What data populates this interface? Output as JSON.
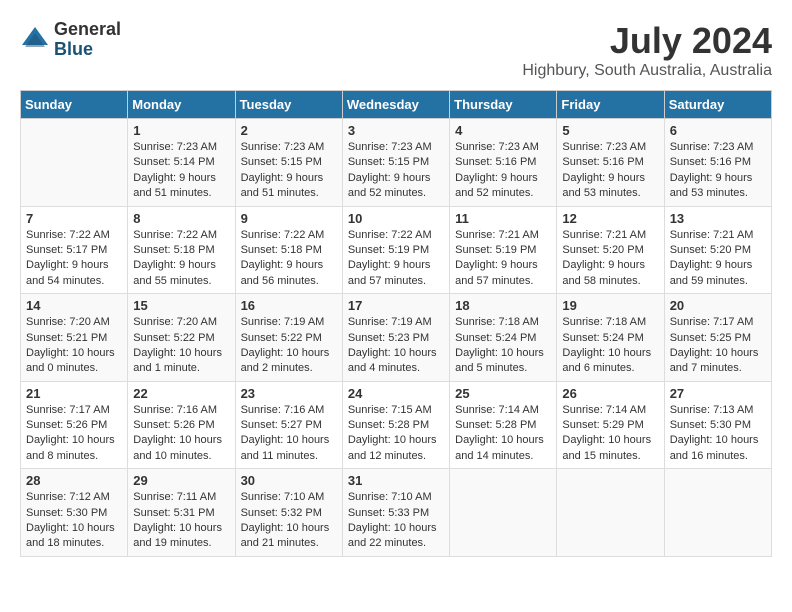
{
  "app": {
    "logo_general": "General",
    "logo_blue": "Blue"
  },
  "header": {
    "month": "July 2024",
    "location": "Highbury, South Australia, Australia"
  },
  "weekdays": [
    "Sunday",
    "Monday",
    "Tuesday",
    "Wednesday",
    "Thursday",
    "Friday",
    "Saturday"
  ],
  "weeks": [
    [
      {
        "day": "",
        "info": ""
      },
      {
        "day": "1",
        "info": "Sunrise: 7:23 AM\nSunset: 5:14 PM\nDaylight: 9 hours and 51 minutes."
      },
      {
        "day": "2",
        "info": "Sunrise: 7:23 AM\nSunset: 5:15 PM\nDaylight: 9 hours and 51 minutes."
      },
      {
        "day": "3",
        "info": "Sunrise: 7:23 AM\nSunset: 5:15 PM\nDaylight: 9 hours and 52 minutes."
      },
      {
        "day": "4",
        "info": "Sunrise: 7:23 AM\nSunset: 5:16 PM\nDaylight: 9 hours and 52 minutes."
      },
      {
        "day": "5",
        "info": "Sunrise: 7:23 AM\nSunset: 5:16 PM\nDaylight: 9 hours and 53 minutes."
      },
      {
        "day": "6",
        "info": "Sunrise: 7:23 AM\nSunset: 5:16 PM\nDaylight: 9 hours and 53 minutes."
      }
    ],
    [
      {
        "day": "7",
        "info": "Sunrise: 7:22 AM\nSunset: 5:17 PM\nDaylight: 9 hours and 54 minutes."
      },
      {
        "day": "8",
        "info": "Sunrise: 7:22 AM\nSunset: 5:18 PM\nDaylight: 9 hours and 55 minutes."
      },
      {
        "day": "9",
        "info": "Sunrise: 7:22 AM\nSunset: 5:18 PM\nDaylight: 9 hours and 56 minutes."
      },
      {
        "day": "10",
        "info": "Sunrise: 7:22 AM\nSunset: 5:19 PM\nDaylight: 9 hours and 57 minutes."
      },
      {
        "day": "11",
        "info": "Sunrise: 7:21 AM\nSunset: 5:19 PM\nDaylight: 9 hours and 57 minutes."
      },
      {
        "day": "12",
        "info": "Sunrise: 7:21 AM\nSunset: 5:20 PM\nDaylight: 9 hours and 58 minutes."
      },
      {
        "day": "13",
        "info": "Sunrise: 7:21 AM\nSunset: 5:20 PM\nDaylight: 9 hours and 59 minutes."
      }
    ],
    [
      {
        "day": "14",
        "info": "Sunrise: 7:20 AM\nSunset: 5:21 PM\nDaylight: 10 hours and 0 minutes."
      },
      {
        "day": "15",
        "info": "Sunrise: 7:20 AM\nSunset: 5:22 PM\nDaylight: 10 hours and 1 minute."
      },
      {
        "day": "16",
        "info": "Sunrise: 7:19 AM\nSunset: 5:22 PM\nDaylight: 10 hours and 2 minutes."
      },
      {
        "day": "17",
        "info": "Sunrise: 7:19 AM\nSunset: 5:23 PM\nDaylight: 10 hours and 4 minutes."
      },
      {
        "day": "18",
        "info": "Sunrise: 7:18 AM\nSunset: 5:24 PM\nDaylight: 10 hours and 5 minutes."
      },
      {
        "day": "19",
        "info": "Sunrise: 7:18 AM\nSunset: 5:24 PM\nDaylight: 10 hours and 6 minutes."
      },
      {
        "day": "20",
        "info": "Sunrise: 7:17 AM\nSunset: 5:25 PM\nDaylight: 10 hours and 7 minutes."
      }
    ],
    [
      {
        "day": "21",
        "info": "Sunrise: 7:17 AM\nSunset: 5:26 PM\nDaylight: 10 hours and 8 minutes."
      },
      {
        "day": "22",
        "info": "Sunrise: 7:16 AM\nSunset: 5:26 PM\nDaylight: 10 hours and 10 minutes."
      },
      {
        "day": "23",
        "info": "Sunrise: 7:16 AM\nSunset: 5:27 PM\nDaylight: 10 hours and 11 minutes."
      },
      {
        "day": "24",
        "info": "Sunrise: 7:15 AM\nSunset: 5:28 PM\nDaylight: 10 hours and 12 minutes."
      },
      {
        "day": "25",
        "info": "Sunrise: 7:14 AM\nSunset: 5:28 PM\nDaylight: 10 hours and 14 minutes."
      },
      {
        "day": "26",
        "info": "Sunrise: 7:14 AM\nSunset: 5:29 PM\nDaylight: 10 hours and 15 minutes."
      },
      {
        "day": "27",
        "info": "Sunrise: 7:13 AM\nSunset: 5:30 PM\nDaylight: 10 hours and 16 minutes."
      }
    ],
    [
      {
        "day": "28",
        "info": "Sunrise: 7:12 AM\nSunset: 5:30 PM\nDaylight: 10 hours and 18 minutes."
      },
      {
        "day": "29",
        "info": "Sunrise: 7:11 AM\nSunset: 5:31 PM\nDaylight: 10 hours and 19 minutes."
      },
      {
        "day": "30",
        "info": "Sunrise: 7:10 AM\nSunset: 5:32 PM\nDaylight: 10 hours and 21 minutes."
      },
      {
        "day": "31",
        "info": "Sunrise: 7:10 AM\nSunset: 5:33 PM\nDaylight: 10 hours and 22 minutes."
      },
      {
        "day": "",
        "info": ""
      },
      {
        "day": "",
        "info": ""
      },
      {
        "day": "",
        "info": ""
      }
    ]
  ]
}
